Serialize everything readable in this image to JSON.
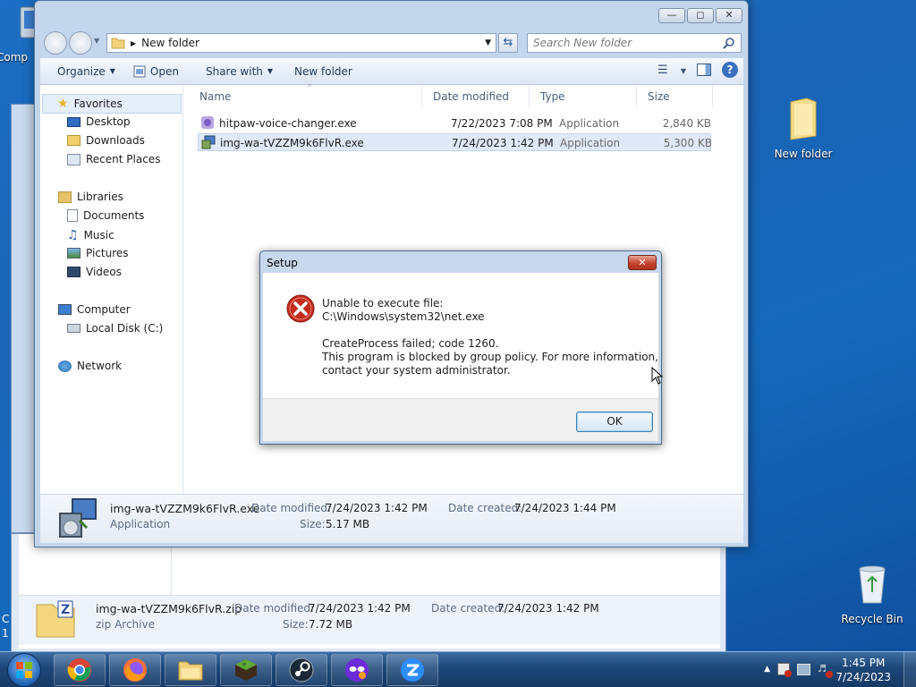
{
  "desktop": {
    "icons": [
      {
        "label": "Comp"
      },
      {
        "label": "New folder"
      },
      {
        "label": "Recycle Bin"
      }
    ],
    "fragments": [
      "C",
      "1"
    ]
  },
  "explorer": {
    "address": "New folder",
    "search_placeholder": "Search New folder",
    "toolbar": {
      "organize": "Organize",
      "open": "Open",
      "share_with": "Share with",
      "new_folder": "New folder"
    },
    "nav": {
      "favorites": "Favorites",
      "desktop": "Desktop",
      "downloads": "Downloads",
      "recent_places": "Recent Places",
      "libraries": "Libraries",
      "documents": "Documents",
      "music": "Music",
      "pictures": "Pictures",
      "videos": "Videos",
      "computer": "Computer",
      "local_disk": "Local Disk (C:)",
      "network": "Network"
    },
    "columns": {
      "name": "Name",
      "date_modified": "Date modified",
      "type": "Type",
      "size": "Size"
    },
    "files": [
      {
        "name": "hitpaw-voice-changer.exe",
        "date": "7/22/2023 7:08 PM",
        "type": "Application",
        "size": "2,840 KB"
      },
      {
        "name": "img-wa-tVZZM9k6FlvR.exe",
        "date": "7/24/2023 1:42 PM",
        "type": "Application",
        "size": "5,300 KB"
      }
    ],
    "details": {
      "name": "img-wa-tVZZM9k6FlvR.exe",
      "kind": "Application",
      "modified_label": "Date modified:",
      "modified": "7/24/2023 1:42 PM",
      "created_label": "Date created:",
      "created": "7/24/2023 1:44 PM",
      "size_label": "Size:",
      "size": "5.17 MB"
    }
  },
  "background_window": {
    "details": {
      "name": "img-wa-tVZZM9k6FlvR.zip",
      "kind": "zip Archive",
      "modified_label": "Date modified:",
      "modified": "7/24/2023 1:42 PM",
      "created_label": "Date created:",
      "created": "7/24/2023 1:42 PM",
      "size_label": "Size:",
      "size": "7.72 MB"
    }
  },
  "dialog": {
    "title": "Setup",
    "line1": "Unable to execute file:",
    "line2": "C:\\Windows\\system32\\net.exe",
    "line3": "CreateProcess failed; code 1260.",
    "line4": "This program is blocked by group policy. For more information,",
    "line5": "contact your system administrator.",
    "ok": "OK"
  },
  "taskbar": {
    "apps": [
      "chrome-icon",
      "firefox-icon",
      "file-explorer-icon",
      "minecraft-icon",
      "steam-icon",
      "mask-app-icon",
      "zoom-icon"
    ],
    "time": "1:45 PM",
    "date": "7/24/2023"
  },
  "colors": {
    "error_red": "#c42b1c",
    "accent": "#1c6fc4"
  }
}
